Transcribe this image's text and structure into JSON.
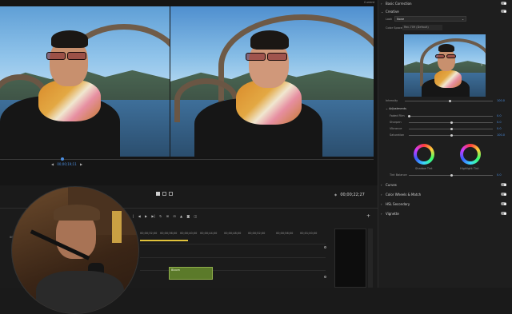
{
  "monitor": {
    "top_label": "Current",
    "left_timecode": "00;00;19;11",
    "right_timecode": "00;00;22;27",
    "nav_prev": "◀",
    "nav_next": "▶"
  },
  "panel": {
    "basic_correction": "Basic Correction",
    "creative": "Creative",
    "look_label": "Look",
    "look_value": "None",
    "color_space_label": "Color Space",
    "color_space_value": "Rec.709 (Default)",
    "intensity_label": "Intensity",
    "intensity_value": "100.0",
    "adjustments_label": "Adjustments",
    "sliders": [
      {
        "label": "Faded Film",
        "value": "0.0"
      },
      {
        "label": "Sharpen",
        "value": "0.0"
      },
      {
        "label": "Vibrance",
        "value": "0.0"
      },
      {
        "label": "Saturation",
        "value": "100.0"
      }
    ],
    "shadow_tint": "Shadow Tint",
    "highlight_tint": "Highlight Tint",
    "tint_balance_label": "Tint Balance",
    "tint_balance_value": "0.0",
    "sections": [
      "Curves",
      "Color Wheels & Match",
      "HSL Secondary",
      "Vignette"
    ]
  },
  "timeline": {
    "ruler": [
      "00;00;32;00",
      "00;00;36;00",
      "00;00;40;00",
      "00;00;44;00",
      "00;00;48;00",
      "00;00;52;00",
      "00;00;56;00",
      "00;01;00;00"
    ],
    "left_tick": "00;00;28",
    "clip_label": "Bloom"
  }
}
